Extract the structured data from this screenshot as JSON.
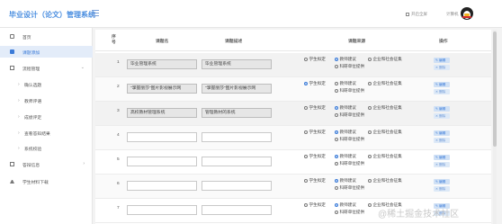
{
  "header": {
    "title": "毕业设计（论文）管理系统",
    "fullscreen_label": "开启全屏",
    "username": "计算机"
  },
  "sidebar": {
    "items": [
      {
        "label": "首页",
        "icon": "home-icon"
      },
      {
        "label": "课题添加",
        "icon": "check-square-icon"
      },
      {
        "label": "流程管理",
        "icon": "grid-icon"
      },
      {
        "label": "确认选题"
      },
      {
        "label": "教师评语"
      },
      {
        "label": "成绩评定"
      },
      {
        "label": "查看答辩结果"
      },
      {
        "label": "系统校验"
      },
      {
        "label": "答辩信息",
        "icon": "square-icon"
      },
      {
        "label": "学生材料下载",
        "icon": "upload-icon"
      }
    ]
  },
  "table": {
    "headers": {
      "index": "序号",
      "title": "课题名",
      "desc": "课题描述",
      "source": "课题来源",
      "action": "操作"
    },
    "source_options": [
      "学生拟定",
      "教师建议",
      "企业和社会征集",
      "科研单位提供"
    ],
    "edit_label": "✎ 编辑",
    "delete_label": "✕ 删除",
    "rows": [
      {
        "index": "1",
        "title": "毕业管理系统",
        "desc": "毕业管理系统",
        "selected": 1
      },
      {
        "index": "2",
        "title": "\"掌握丽莎\"图片影视展示网",
        "desc": "\"掌握丽莎\"图片影视展示网",
        "selected": 0
      },
      {
        "index": "3",
        "title": "高校教材管理系统",
        "desc": "管理教材的系统",
        "selected": 1
      },
      {
        "index": "4",
        "title": "",
        "desc": "",
        "selected": 1
      },
      {
        "index": "5",
        "title": "",
        "desc": "",
        "selected": 1
      },
      {
        "index": "6",
        "title": "",
        "desc": "",
        "selected": 1
      },
      {
        "index": "7",
        "title": "",
        "desc": "",
        "selected": 1
      }
    ]
  },
  "watermark": "@稀土掘金技术社区",
  "colors": {
    "accent": "#3b7bd8",
    "title": "#4c8fe0"
  }
}
